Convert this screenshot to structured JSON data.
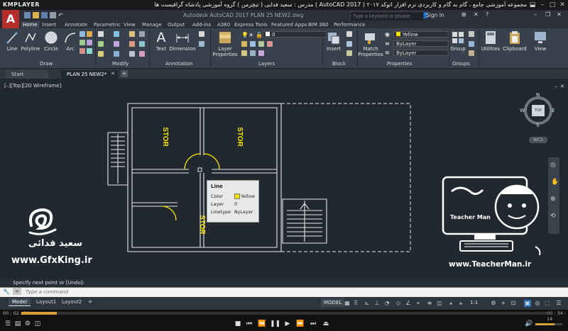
{
  "player": {
    "logo": "KMPLAYER",
    "title": "مجموعه آموزشی جامع ، گام به گام و کاربردی نرم افزار  اتوکد ۲۰۱۷ ( AutoCAD 2017 )  مدرس : سعید فدایی ( تیچرمن ) گروه آموزشی پادشاه گرافیست ها",
    "time_elapsed": "00 : 02 : 19",
    "time_total": "00 : 34 : 14",
    "progress": 0.068
  },
  "acad": {
    "logo": "A",
    "title": "Autodesk AutoCAD 2017    PLAN 25 NEW2.dwg",
    "search_placeholder": "Type a keyword or phrase",
    "sign_in": "Sign In"
  },
  "ribbon_tabs": [
    "Home",
    "Insert",
    "Annotate",
    "Parametric",
    "View",
    "Manage",
    "Output",
    "Add-ins",
    "A360",
    "Express Tools",
    "Featured Apps",
    "BIM 360",
    "Performance"
  ],
  "ribbon": {
    "draw": {
      "title": "Draw",
      "tools": [
        "Line",
        "Polyline",
        "Circle",
        "Arc"
      ]
    },
    "modify": {
      "title": "Modify"
    },
    "annotation": {
      "title": "Annotation",
      "tools": [
        "Text",
        "Dimension"
      ]
    },
    "layers": {
      "title": "Layers",
      "tool_line1": "Layer",
      "tool_line2": "Properties",
      "current_layer": "0"
    },
    "block": {
      "title": "Block",
      "tool": "Insert"
    },
    "properties": {
      "title": "Properties",
      "tool_line1": "Match",
      "tool_line2": "Properties",
      "color": "Yellow",
      "linetype": "ByLayer",
      "lineweight": "ByLayer"
    },
    "groups": {
      "title": "Groups",
      "tool": "Group"
    },
    "utilities": "Utilities",
    "clipboard": "Clipboard",
    "view": "View"
  },
  "file_tabs": [
    "Start",
    "PLAN 25 NEW2*"
  ],
  "viewport": {
    "label": "[–][Top][2D Wireframe]",
    "viewcube_face": "TOP",
    "compass": {
      "n": "N",
      "s": "S",
      "e": "E",
      "w": "W"
    },
    "wcs": "WCS"
  },
  "drawing": {
    "labels": [
      "STOR",
      "STOR",
      "STOR"
    ]
  },
  "tooltip": {
    "title": "Line",
    "rows": [
      {
        "key": "Color",
        "value": "Yellow"
      },
      {
        "key": "Layer",
        "value": "0"
      },
      {
        "key": "Linetype",
        "value": "ByLayer"
      }
    ]
  },
  "watermarks": {
    "gfxking": "www.GfxKing.ir",
    "sayed": "سعید فدائی",
    "teacherman_url": "www.TeacherMan.ir",
    "teacherman_sign": "Teacher Man"
  },
  "command": {
    "history": "Specify next point or [Undo]:",
    "placeholder": "Type a command"
  },
  "layout_tabs": [
    "Model",
    "Layout1",
    "Layout2"
  ],
  "status": {
    "model": "MODEL",
    "scale": "1:1"
  },
  "colors": {
    "accent_yellow": "#f2e200",
    "autocad_red": "#b52c2c",
    "canvas": "#212830",
    "lines": "#e8e8e8"
  }
}
